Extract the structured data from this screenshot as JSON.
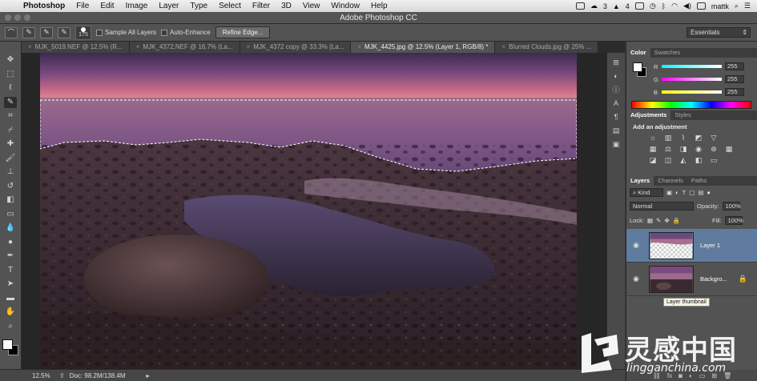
{
  "menubar": {
    "app": "Photoshop",
    "items": [
      "File",
      "Edit",
      "Image",
      "Layer",
      "Type",
      "Select",
      "Filter",
      "3D",
      "View",
      "Window",
      "Help"
    ],
    "status": {
      "badge_a": "3",
      "badge_b": "4",
      "user": "mattk"
    }
  },
  "window": {
    "title": "Adobe Photoshop CC"
  },
  "options": {
    "brush_size": "175",
    "sample_all_layers": "Sample All Layers",
    "auto_enhance": "Auto-Enhance",
    "refine_edge": "Refine Edge...",
    "workspace": "Essentials"
  },
  "tabs": [
    {
      "label": "MJK_5019.NEF @ 12.5% (R..."
    },
    {
      "label": "MJK_4372.NEF @ 16.7% (La..."
    },
    {
      "label": "MJK_4372 copy @ 33.3% (La..."
    },
    {
      "label": "MJK_4425.jpg @ 12.5% (Layer 1, RGB/8) *",
      "active": true
    },
    {
      "label": "Blurred Clouds.jpg @ 25% ..."
    }
  ],
  "status": {
    "zoom": "12.5%",
    "doc": "Doc: 98.2M/138.4M"
  },
  "color_panel": {
    "tabs": [
      "Color",
      "Swatches"
    ],
    "channels": [
      {
        "label": "R",
        "value": "255"
      },
      {
        "label": "G",
        "value": "255"
      },
      {
        "label": "B",
        "value": "255"
      }
    ]
  },
  "adjustments_panel": {
    "tabs": [
      "Adjustments",
      "Styles"
    ],
    "title": "Add an adjustment"
  },
  "layers_panel": {
    "tabs": [
      "Layers",
      "Channels",
      "Paths"
    ],
    "kind": "Kind",
    "blend_mode": "Normal",
    "opacity_label": "Opacity:",
    "opacity": "100%",
    "lock_label": "Lock:",
    "fill_label": "Fill:",
    "fill": "100%",
    "tooltip": "Layer thumbnail",
    "layers": [
      {
        "name": "Layer 1",
        "selected": true
      },
      {
        "name": "Backgro..."
      }
    ]
  },
  "watermark": {
    "title": "灵感中国",
    "url": "lingganchina.com"
  }
}
